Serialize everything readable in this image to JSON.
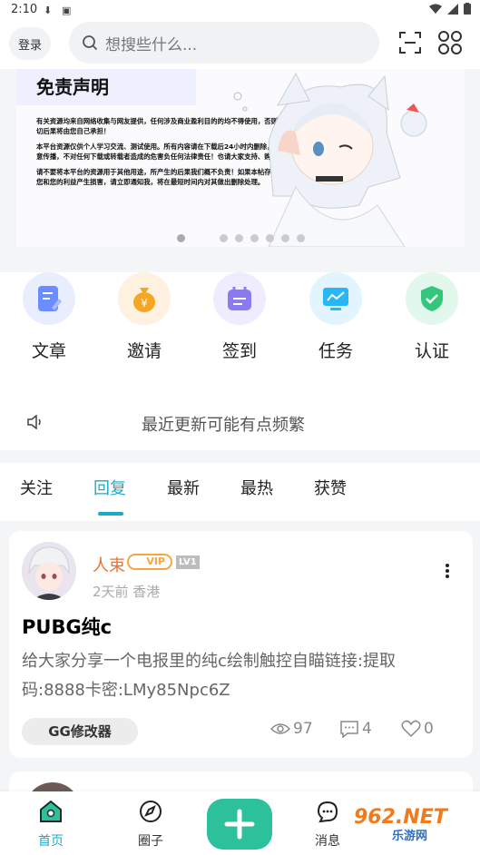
{
  "status_bar": {
    "time": "2:10"
  },
  "header": {
    "login_label": "登录",
    "search_placeholder": "想搜些什么..."
  },
  "banner": {
    "title": "免责声明",
    "paragraphs": [
      "有关资源均来自网络收集与网友提供，任何涉及商业盈利目的的均不得使用，否则产生的一切后果将由您自己承担！",
      "本平台资源仅供个人学习交流、测试使用。所有内容请在下载后24小时内删除，禁止非法恶意传播，不对任何下载或转载者造成的危害负任何法律责任！也请大家支持、购买正版！",
      "请不要将本平台的资源用于其他用途，所产生的后果我们概不负责！如果本帖存在的内容对您和您的利益产生损害，请立即通知我，将在最短时间内对其做出删除处理。"
    ],
    "dots_count": 6,
    "active_dot": 0
  },
  "menu": {
    "items": [
      {
        "label": "文章",
        "icon": "article-icon",
        "color": "#6b8cff"
      },
      {
        "label": "邀请",
        "icon": "money-bag-icon",
        "color": "#f5a623"
      },
      {
        "label": "签到",
        "icon": "calendar-icon",
        "color": "#8a7cf0"
      },
      {
        "label": "任务",
        "icon": "monitor-chart-icon",
        "color": "#29b6f6"
      },
      {
        "label": "认证",
        "icon": "shield-check-icon",
        "color": "#34c77b"
      }
    ]
  },
  "notice": {
    "text": "最近更新可能有点频繁"
  },
  "tabs": {
    "items": [
      "关注",
      "回复",
      "最新",
      "最热",
      "获赞"
    ],
    "active_index": 1
  },
  "post": {
    "username": "人束",
    "vip_label": "VIP",
    "level_label": "LV1",
    "meta": "2天前 香港",
    "title": "PUBG纯c",
    "body": "给大家分享一个电报里的纯c绘制触控自瞄链接:提取码:8888卡密:LMy85Npc6Z",
    "tag": "GG修改器",
    "views": "97",
    "comments": "4",
    "likes": "0"
  },
  "bottom_nav": {
    "items": [
      {
        "label": "首页",
        "icon": "home-icon"
      },
      {
        "label": "圈子",
        "icon": "compass-icon"
      },
      {
        "label": "消息",
        "icon": "chat-icon"
      }
    ],
    "active_index": 0
  },
  "watermark": {
    "brand": "962.NET",
    "sub": "乐游网"
  },
  "colors": {
    "accent": "#1da9c9",
    "plus": "#2cc19a",
    "username": "#e8732b",
    "vip": "#f6a640"
  }
}
